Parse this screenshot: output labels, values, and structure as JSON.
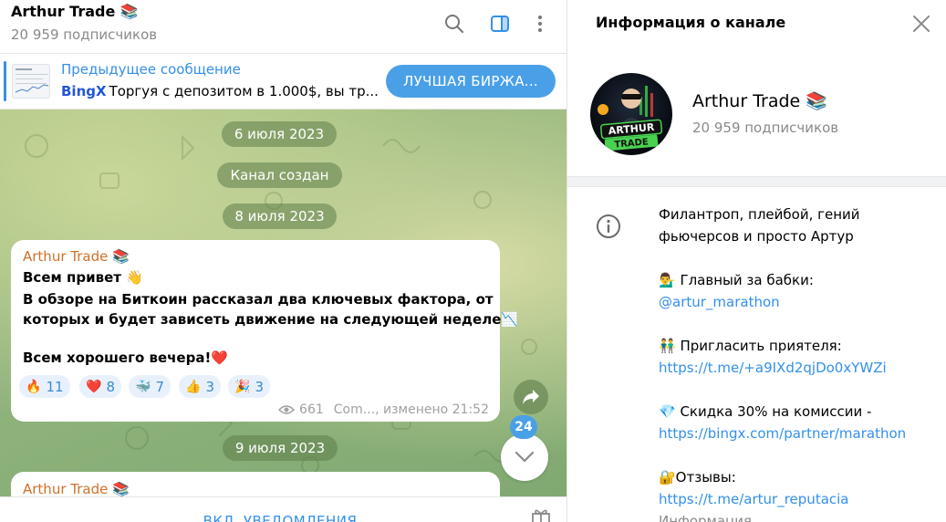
{
  "channel": {
    "title": "Arthur Trade 📚",
    "subscribers": "20 959 подписчиков"
  },
  "pinned": {
    "title": "Предыдущее сообщение",
    "brand": "BingX",
    "text": "Торгуя с депозитом в 1.000$, вы тр...",
    "button_label": "ЛУЧШАЯ БИРЖА..."
  },
  "chat": {
    "date_pills": [
      "6 июля 2023",
      "Канал создан",
      "8 июля 2023",
      "9 июля 2023"
    ],
    "message": {
      "author": "Arthur Trade 📚",
      "lines": [
        "Всем привет 👋",
        "В обзоре на Биткоин рассказал два ключевых фактора, от",
        "которых и будет зависеть движение на следующей неделе📉",
        "Всем хорошего вечера!❤️"
      ],
      "reactions": [
        {
          "emoji": "🔥",
          "count": "11"
        },
        {
          "emoji": "❤️",
          "count": "8"
        },
        {
          "emoji": "🐳",
          "count": "7"
        },
        {
          "emoji": "👍",
          "count": "3"
        },
        {
          "emoji": "🎉",
          "count": "3"
        }
      ],
      "views": "661",
      "meta": "Com..., изменено 21:52"
    },
    "next_author": "Arthur Trade 📚",
    "unread_count": "24"
  },
  "bottombar": {
    "notify_label": "ВКЛ. УВЕДОМЛЕНИЯ"
  },
  "info_panel": {
    "title": "Информация о канале",
    "name": "Arthur Trade 📚",
    "subscribers": "20 959 подписчиков",
    "avatar_text_1": "ARTHUR",
    "avatar_text_2": "TRADE",
    "description": [
      {
        "text": "Филантроп, плейбой, гений",
        "link": false
      },
      {
        "text": "фьючерсов и просто Артур",
        "link": false
      },
      {
        "text": "💁‍♂️ Главный за бабки:",
        "link": false
      },
      {
        "text": "@artur_marathon",
        "link": true
      },
      {
        "text": "👬 Пригласить приятеля:",
        "link": false
      },
      {
        "text": "https://t.me/+a9IXd2qjDo0xYWZi",
        "link": true
      },
      {
        "text": "💎 Скидка 30% на комиссии -",
        "link": false
      },
      {
        "text": "https://bingx.com/partner/marathon",
        "link": true
      },
      {
        "text": "🔐Отзывы:",
        "link": false
      },
      {
        "text": "https://t.me/artur_reputacia",
        "link": true
      },
      {
        "text": "Информация",
        "link": false
      }
    ]
  },
  "colors": {
    "accent": "#3390ec",
    "author": "#d0702a",
    "button": "#4aa0e6"
  }
}
